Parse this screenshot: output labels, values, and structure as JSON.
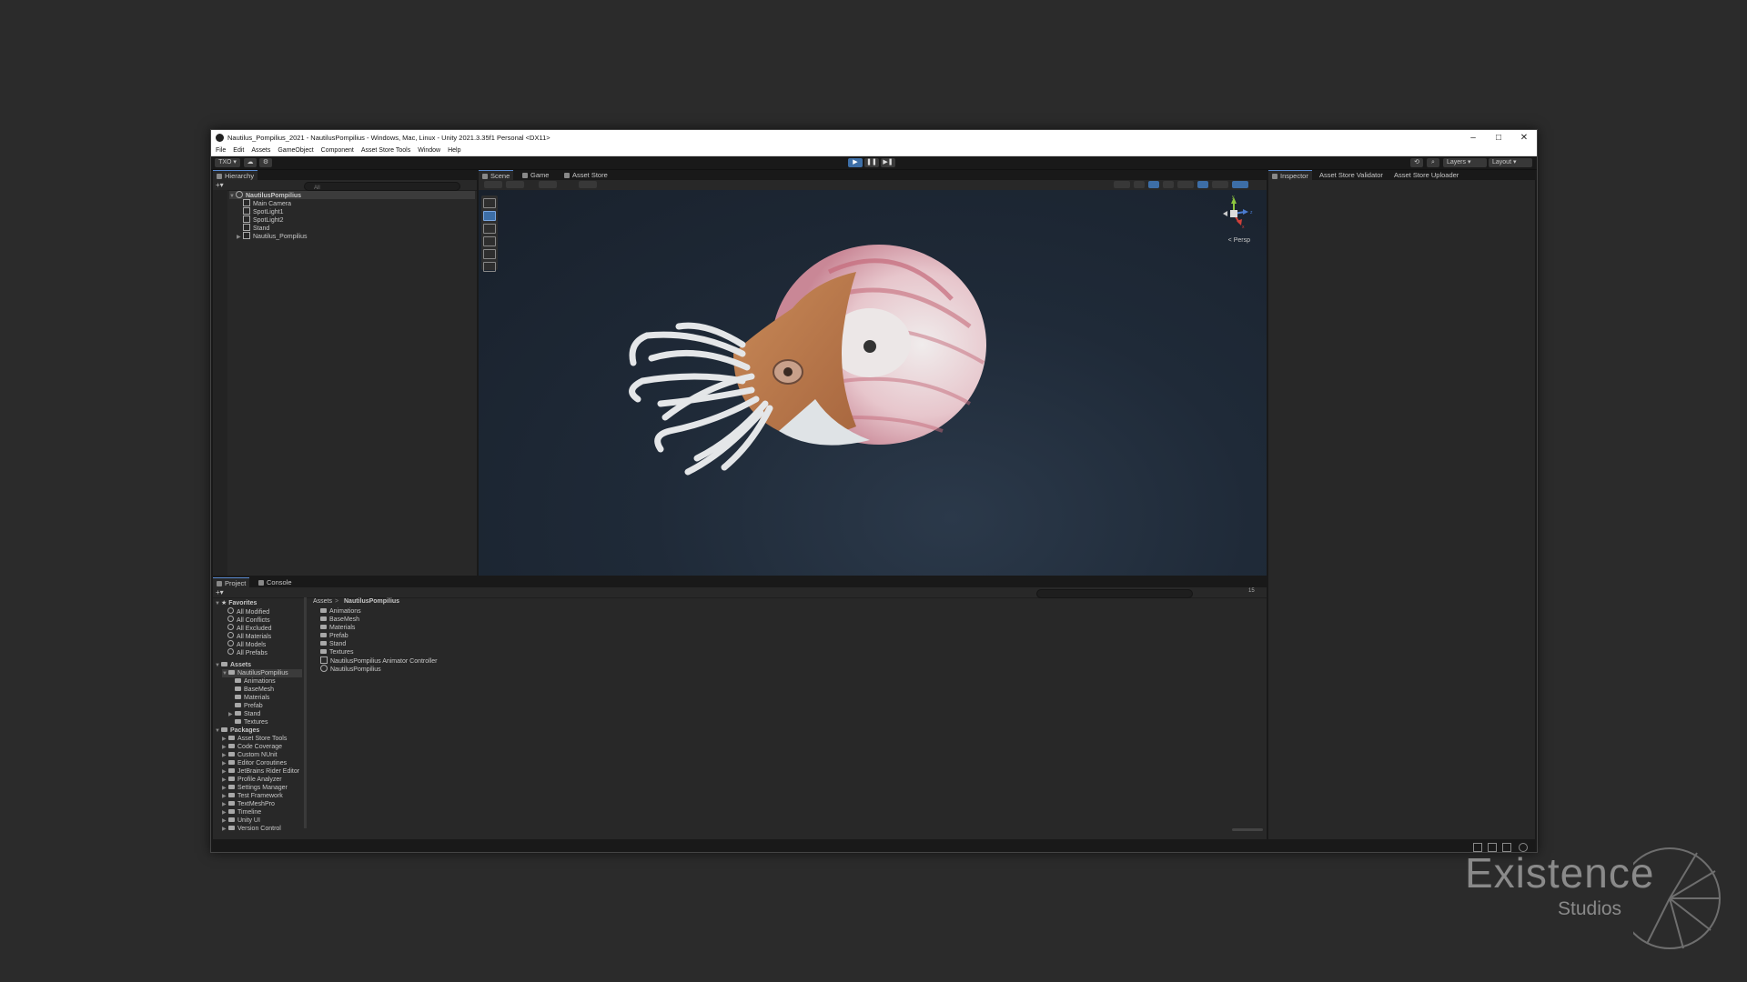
{
  "window": {
    "title": "Nautilus_Pompilius_2021 - NautilusPompilius - Windows, Mac, Linux - Unity 2021.3.35f1 Personal <DX11>",
    "controls": [
      "–",
      "□",
      "✕"
    ]
  },
  "menu": [
    "File",
    "Edit",
    "Assets",
    "GameObject",
    "Component",
    "Asset Store Tools",
    "Window",
    "Help"
  ],
  "toolbar": {
    "account_label": "TXO ▾",
    "layers_label": "Layers",
    "layout_label": "Layout",
    "play_state": "playing"
  },
  "hierarchy": {
    "tab": "Hierarchy",
    "search_placeholder": "All",
    "scene": "NautilusPompilius",
    "items": [
      "Main Camera",
      "SpotLight1",
      "SpotLight2",
      "Stand",
      "Nautilus_Pompilius"
    ]
  },
  "scene": {
    "tabs": [
      "Scene",
      "Game",
      "Asset Store"
    ],
    "persp_label": "< Persp",
    "gizmo": {
      "y": "y",
      "x": "x",
      "z": "z"
    }
  },
  "inspector": {
    "tabs": [
      "Inspector",
      "Asset Store Validator",
      "Asset Store Uploader"
    ]
  },
  "project": {
    "tabs": [
      "Project",
      "Console"
    ],
    "favorites_label": "Favorites",
    "favorites": [
      "All Modified",
      "All Conflicts",
      "All Excluded",
      "All Materials",
      "All Models",
      "All Prefabs"
    ],
    "assets_label": "Assets",
    "assets_root": "NautilusPompilius",
    "assets_children": [
      "Animations",
      "BaseMesh",
      "Materials",
      "Prefab",
      "Stand",
      "Textures"
    ],
    "packages_label": "Packages",
    "packages": [
      "Asset Store Tools",
      "Code Coverage",
      "Custom NUnit",
      "Editor Coroutines",
      "JetBrains Rider Editor",
      "Profile Analyzer",
      "Settings Manager",
      "Test Framework",
      "TextMeshPro",
      "Timeline",
      "Unity UI",
      "Version Control"
    ],
    "breadcrumb": [
      "Assets",
      "NautilusPompilius"
    ],
    "breadcrumb_sep": ">",
    "content": [
      "Animations",
      "BaseMesh",
      "Materials",
      "Prefab",
      "Stand",
      "Textures",
      "NautilusPompilius Animator Controller",
      "NautilusPompilius"
    ],
    "count_label": "15"
  },
  "watermark": {
    "line1": "Existence",
    "line2": "Studios"
  }
}
